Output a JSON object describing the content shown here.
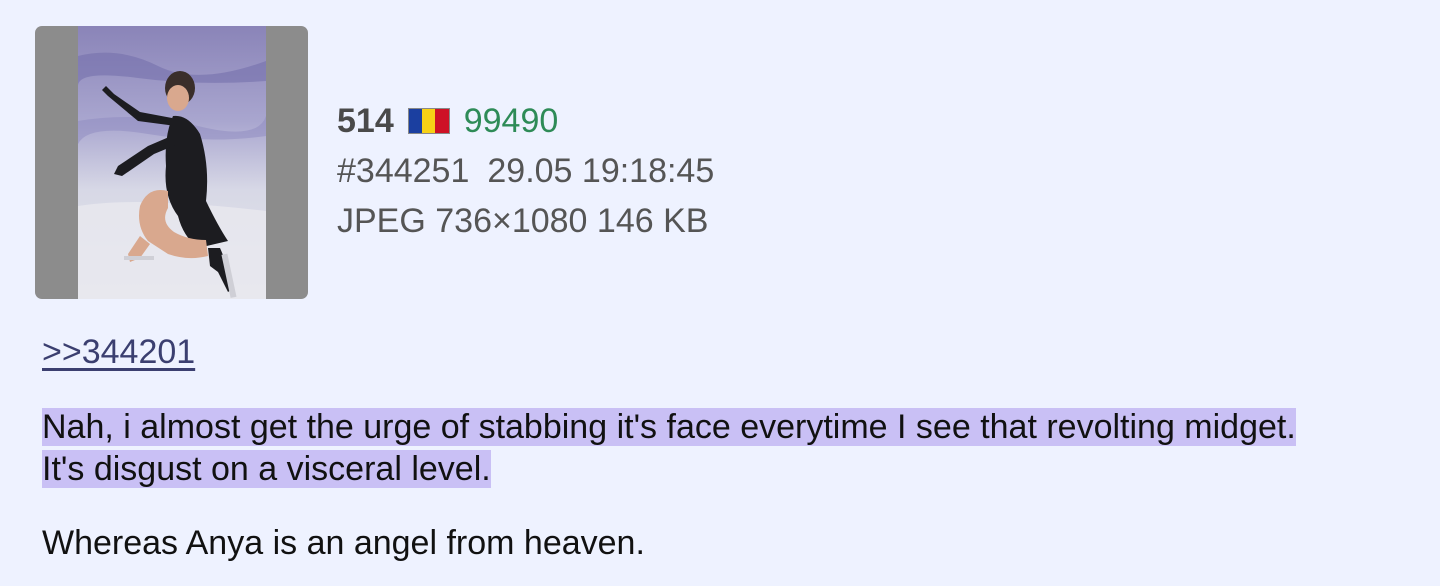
{
  "post": {
    "number": "514",
    "poster_id": "99490",
    "post_id": "#344251",
    "timestamp": "29.05 19:18:45",
    "file_info": "JPEG 736×1080 146 KB",
    "flag": {
      "icon": "romania-flag-icon",
      "colors": [
        "#1b3fa0",
        "#f7d116",
        "#ce1126"
      ]
    },
    "thumbnail": {
      "icon": "figure-skater-thumbnail"
    },
    "reply_link": ">>344201",
    "greentext_line1": "Nah, i almost get the urge of stabbing it's face everytime I see that revolting midget.",
    "greentext_line2": "It's disgust on a visceral level.",
    "paragraph2": "Whereas Anya is an angel from heaven."
  },
  "colors": {
    "background": "#eef2ff",
    "poster_id": "#2e8b57",
    "highlight": "#c9c0f5",
    "link": "#3b3f70"
  }
}
